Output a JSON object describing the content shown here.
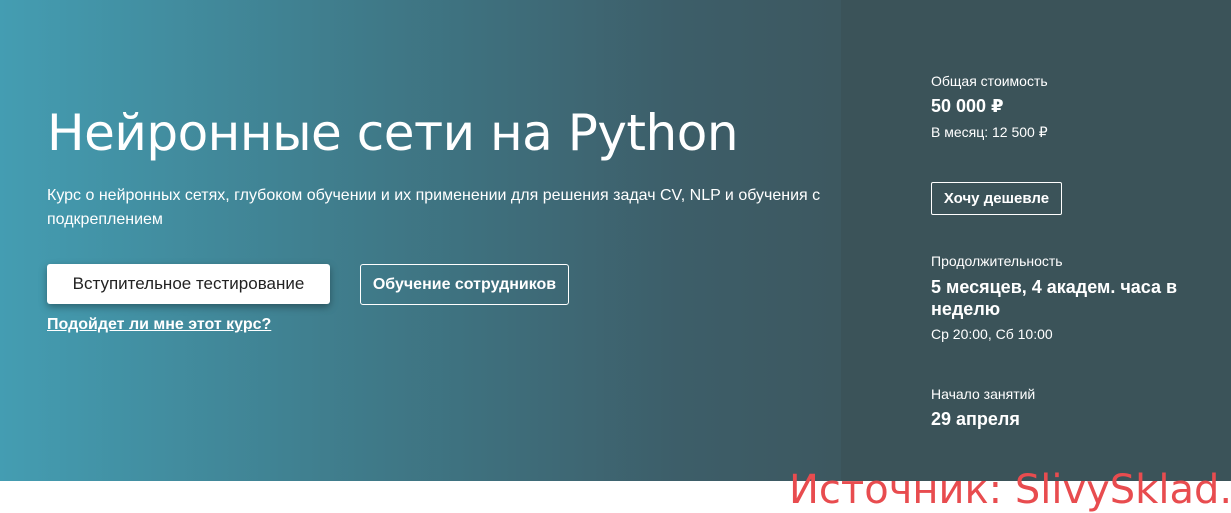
{
  "hero": {
    "title": "Нейронные сети на Python",
    "description": "Курс о нейронных сетях, глубоком обучении и их применении для решения задач CV, NLP и обучения с подкреплением",
    "primary_button": "Вступительное тестирование",
    "secondary_button": "Обучение сотрудников",
    "link": "Подойдет ли мне этот курс?"
  },
  "info": {
    "cost_label": "Общая стоимость",
    "cost_value": "50 000 ₽",
    "monthly": "В месяц: 12 500 ₽",
    "cheaper_button": "Хочу дешевле",
    "duration_label": "Продолжительность",
    "duration_value": "5 месяцев, 4 академ. часа в неделю",
    "schedule": "Ср 20:00, Сб 10:00",
    "start_label": "Начало занятий",
    "start_value": "29 апреля"
  },
  "watermark": "Источник: SlivySklad.ru",
  "colors": {
    "gradient_start": "#449db2",
    "gradient_end": "#3d5860",
    "panel": "#3b5359",
    "watermark": "#e84c4f"
  }
}
